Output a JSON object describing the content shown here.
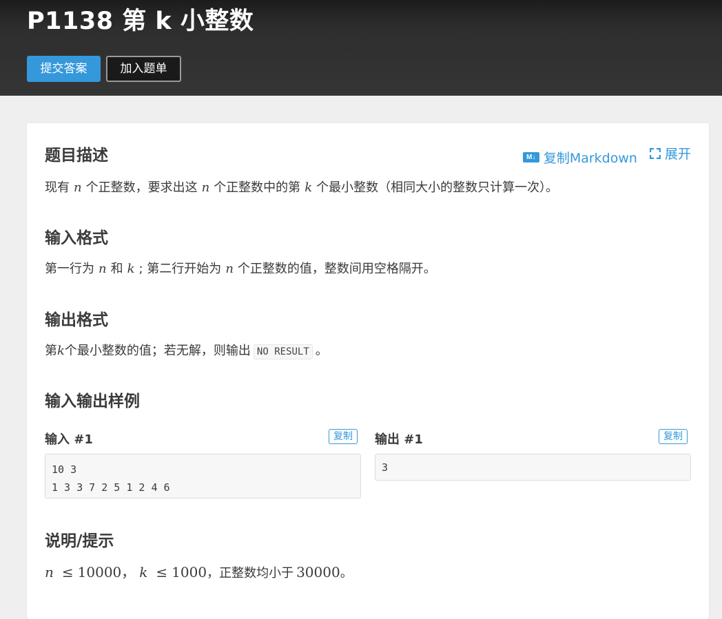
{
  "problem": {
    "title": "P1138 第 k 小整数",
    "buttons": {
      "submit": "提交答案",
      "add_to_list": "加入题单"
    }
  },
  "toolbar": {
    "copy_markdown": "复制Markdown",
    "expand": "展开",
    "markdown_icon_text": "M↓"
  },
  "sections": {
    "description": {
      "heading": "题目描述",
      "t1": "现有",
      "var_n": "n",
      "t2": "个正整数，要求出这",
      "var_n2": "n",
      "t3": "个正整数中的第",
      "var_k": "k",
      "t4": "个最小整数（相同大小的整数只计算一次）。"
    },
    "input_format": {
      "heading": "输入格式",
      "t1": "第一行为",
      "var_n": "n",
      "t2": "和",
      "var_k": "k",
      "t3": "; 第二行开始为",
      "var_n2": "n",
      "t4": "个正整数的值，整数间用空格隔开。"
    },
    "output_format": {
      "heading": "输出格式",
      "t1": "第",
      "var_k": "k",
      "t2": "个最小整数的值；若无解，则输出",
      "code": "NO RESULT",
      "t3": "。"
    },
    "samples": {
      "heading": "输入输出样例",
      "input_label": "输入 #1",
      "output_label": "输出 #1",
      "copy_label": "复制",
      "input_lines": [
        "10 3",
        "1 3 3 7 2 5 1 2 4 6"
      ],
      "output_lines": [
        "3"
      ]
    },
    "hint": {
      "heading": "说明/提示",
      "var_n": "n",
      "le": "≤",
      "n_limit": "10000",
      "sep": "，",
      "var_k": "k",
      "k_limit": "1000",
      "t1": "，正整数均小于",
      "max_val": "30000",
      "t2": "。"
    }
  },
  "colors": {
    "accent": "#3498db",
    "header_bg": "#2e2e2e",
    "page_bg": "#efefef"
  }
}
